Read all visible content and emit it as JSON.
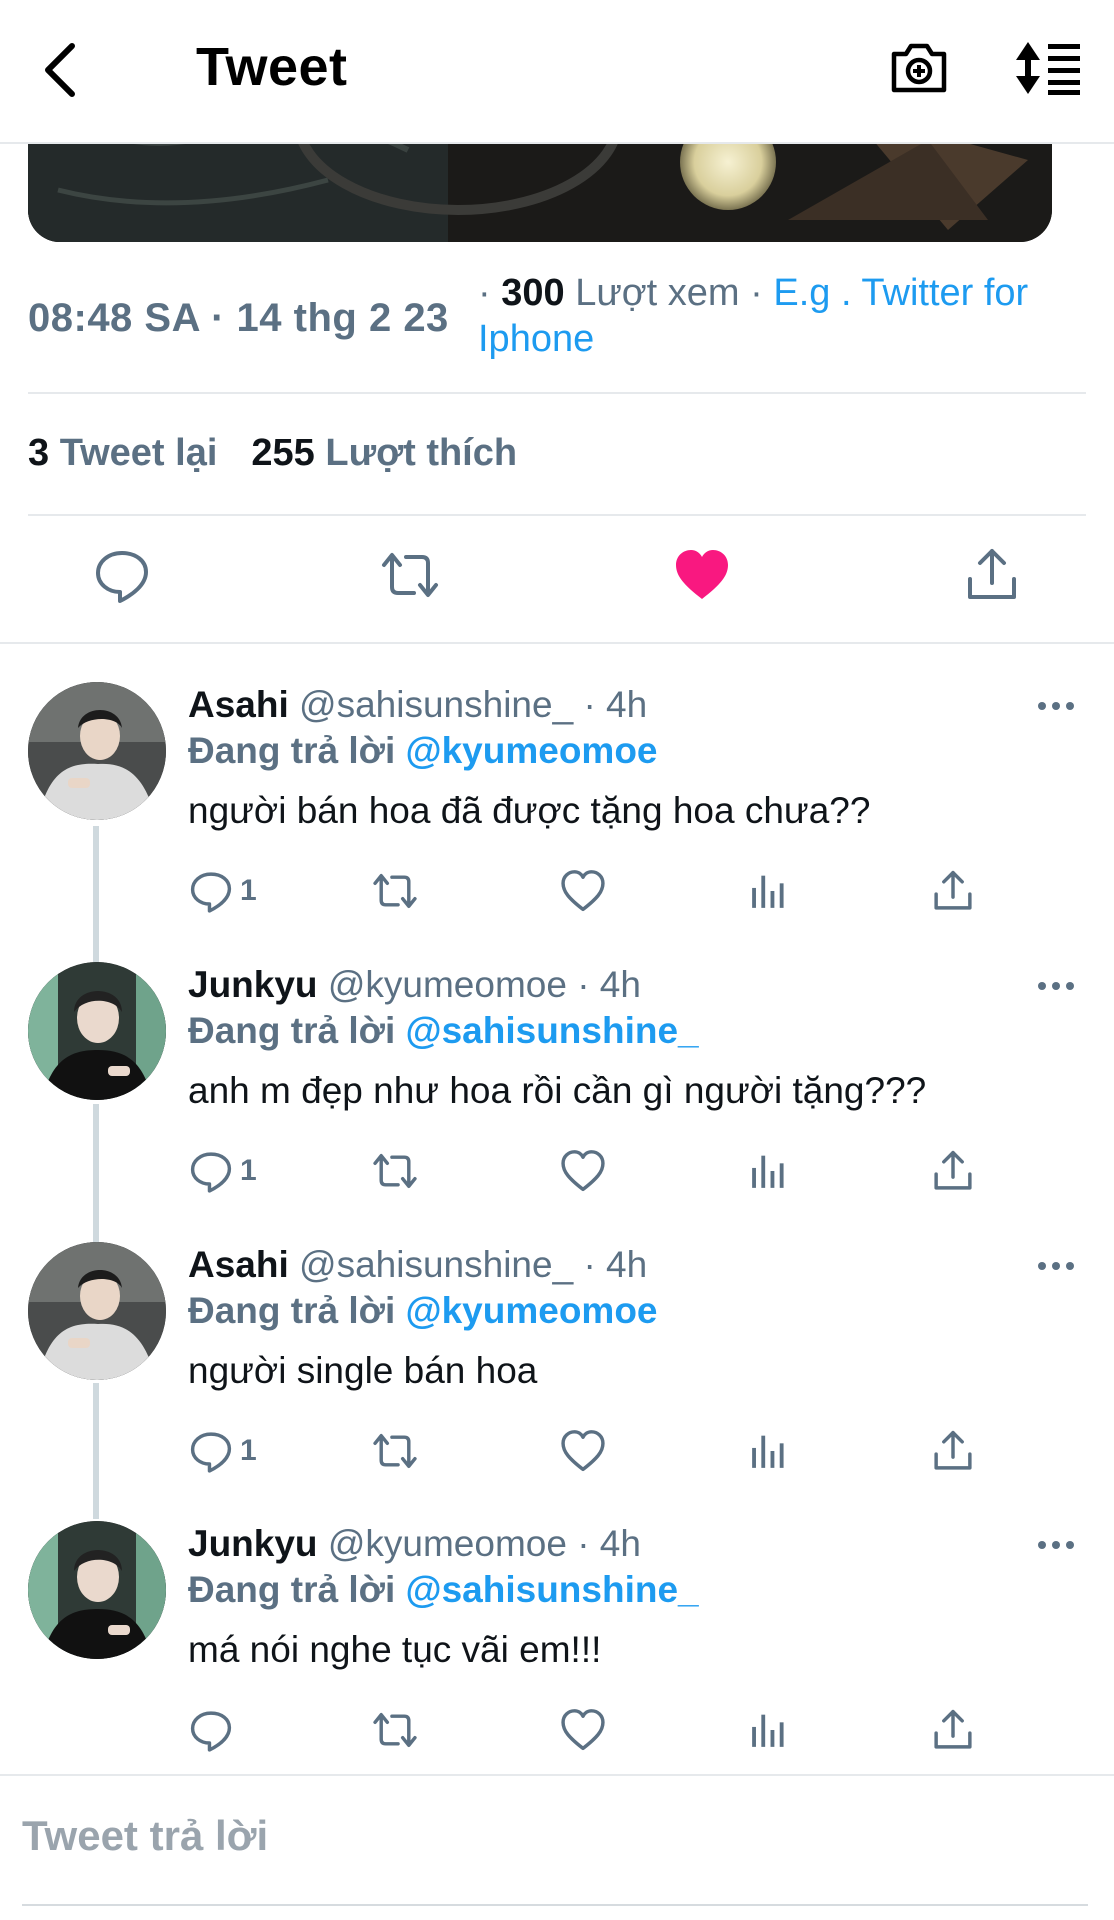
{
  "header": {
    "title": "Tweet",
    "back_icon": "chevron-left-icon",
    "camera_icon": "camera-plus-icon",
    "sort_icon": "sort-list-icon"
  },
  "tweet": {
    "time": "08:48 SA · 14 thg 2 23",
    "views_prefix": "·",
    "views_count": "300",
    "views_label": "Lượt xem",
    "source_prefix": "·",
    "source": "E.g . Twitter for Iphone",
    "retweets_count": "3",
    "retweets_label": "Tweet lại",
    "likes_count": "255",
    "likes_label": "Lượt thích"
  },
  "actions": {
    "reply_icon": "comment-icon",
    "retweet_icon": "retweet-icon",
    "like_icon": "heart-filled-icon",
    "share_icon": "share-icon"
  },
  "colors": {
    "accent": "#1d9bf0",
    "like": "#f91880",
    "muted": "#5b7083"
  },
  "replies": [
    {
      "name": "Asahi",
      "handle": "@sahisunshine_",
      "time": "· 4h",
      "replying_label": "Đang trả lời",
      "mention": "@kyumeomoe",
      "text": "người bán hoa đã được tặng hoa chưa??",
      "reply_count": "1"
    },
    {
      "name": "Junkyu",
      "handle": "@kyumeomoe",
      "time": "· 4h",
      "replying_label": "Đang trả lời",
      "mention": "@sahisunshine_",
      "text": "anh m đẹp như hoa rồi cần gì người tặng???",
      "reply_count": "1"
    },
    {
      "name": "Asahi",
      "handle": "@sahisunshine_",
      "time": "· 4h",
      "replying_label": "Đang trả lời",
      "mention": "@kyumeomoe",
      "text": "người single bán hoa",
      "reply_count": "1"
    },
    {
      "name": "Junkyu",
      "handle": "@kyumeomoe",
      "time": "· 4h",
      "replying_label": "Đang trả lời",
      "mention": "@sahisunshine_",
      "text": "má nói nghe tục vãi em!!!",
      "reply_count": ""
    }
  ],
  "composer": {
    "placeholder": "Tweet trả lời"
  }
}
